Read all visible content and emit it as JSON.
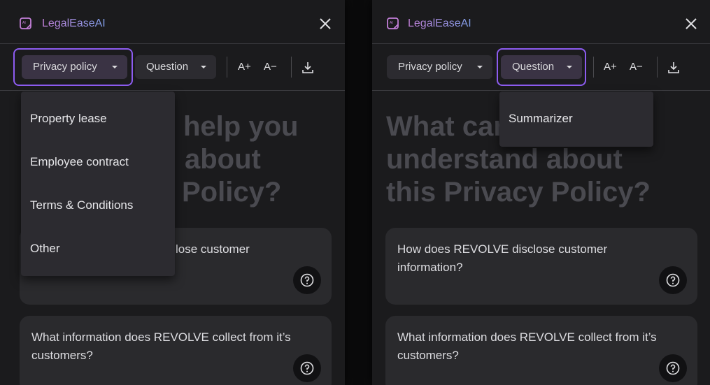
{
  "app": {
    "title": "LegalEaseAI"
  },
  "toolbar": {
    "doc_type": "Privacy policy",
    "mode": "Question",
    "font_increase": "A+",
    "font_decrease": "A−"
  },
  "hero": {
    "full": [
      "What can I help you",
      "understand about",
      "this Privacy Policy?"
    ],
    "left_visible": [
      "help you",
      "about",
      "Policy?"
    ],
    "right_visible": [
      "What car",
      "understand about",
      "this Privacy Policy?"
    ]
  },
  "questions": [
    {
      "text": "How does REVOLVE disclose customer information?",
      "left_visible": "lose customer"
    },
    {
      "text": "What information does REVOLVE collect from it’s customers?"
    }
  ],
  "doc_type_menu": {
    "options": [
      "Property lease",
      "Employee contract",
      "Terms & Conditions",
      "Other"
    ]
  },
  "mode_menu": {
    "options": [
      "Summarizer"
    ]
  },
  "colors": {
    "accent": "#8d5cf0",
    "panel_bg": "#1b1b1d",
    "card_bg": "#2a2a2d",
    "menu_bg": "#2c2b30"
  },
  "icons": {
    "logo": "ai-document-icon",
    "close": "close-icon",
    "caret": "chevron-down-icon",
    "download": "download-icon",
    "help": "question-circle-icon"
  }
}
